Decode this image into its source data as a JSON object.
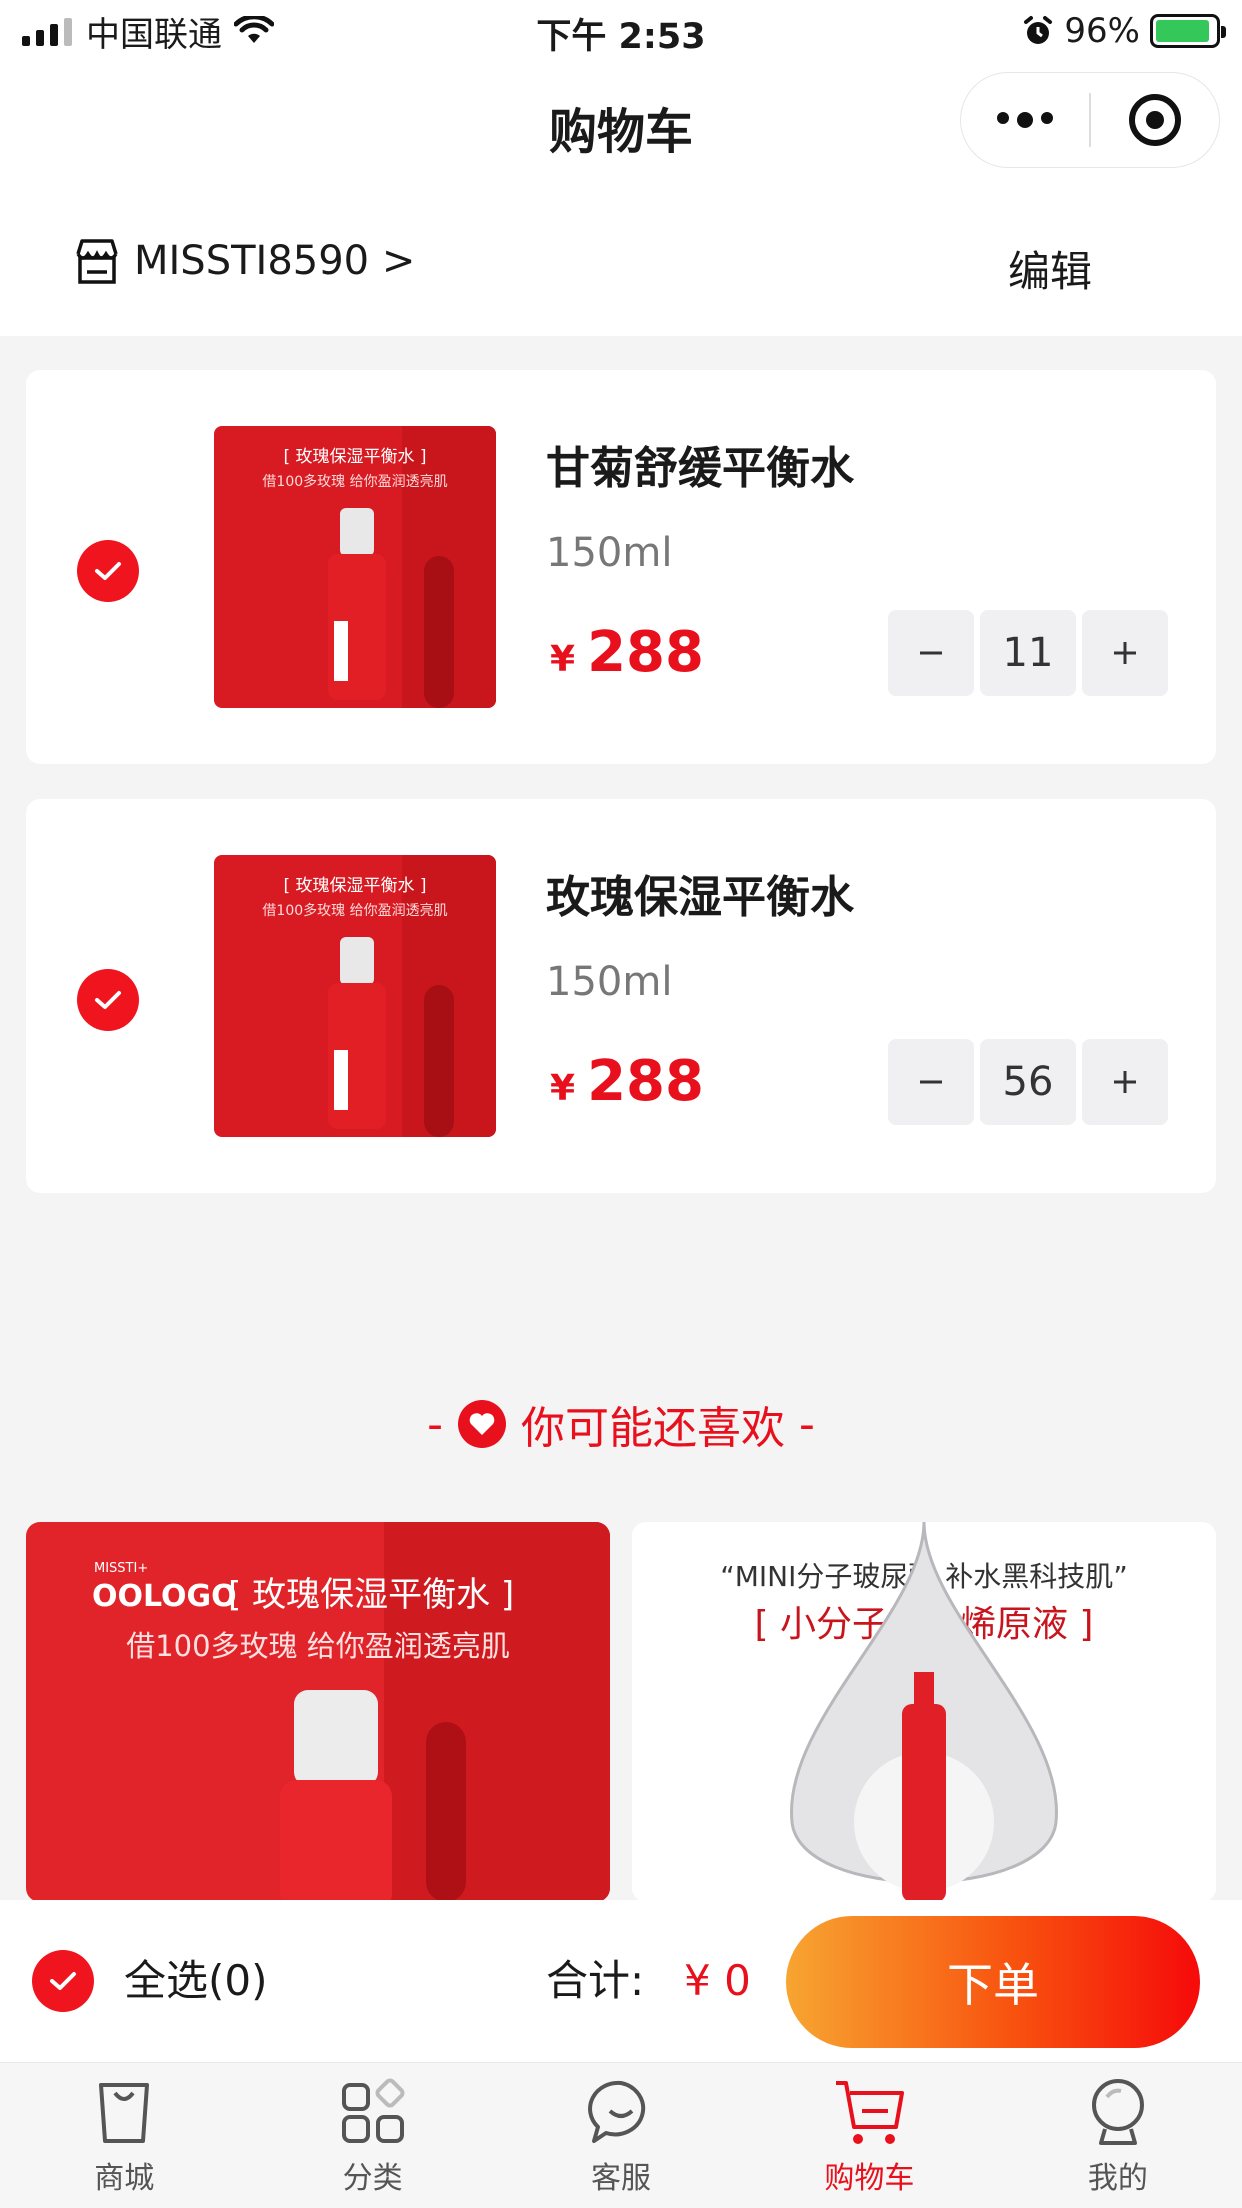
{
  "status_bar": {
    "carrier": "中国联通",
    "time": "下午 2:53",
    "battery": "96%"
  },
  "nav": {
    "title": "购物车"
  },
  "store": {
    "name": "MISSTI8590 >",
    "edit_label": "编辑"
  },
  "cart": {
    "items": [
      {
        "name": "甘菊舒缓平衡水",
        "spec": "150ml",
        "currency": "¥",
        "price": "288",
        "qty": "11",
        "checked": true
      },
      {
        "name": "玫瑰保湿平衡水",
        "spec": "150ml",
        "currency": "¥",
        "price": "288",
        "qty": "56",
        "checked": true
      }
    ],
    "product_image": {
      "brand": "OOLOGO",
      "tag": "[ 玫瑰保湿平衡水 ]",
      "sub": "借100多玫瑰 给你盈润透亮肌"
    }
  },
  "recommend": {
    "title": "你可能还喜欢",
    "tiles": [
      {
        "brand_top": "MISSTI+",
        "brand": "OOLOGO",
        "tag": "[ 玫瑰保湿平衡水 ]",
        "sub": "借100多玫瑰 给你盈润透亮肌"
      },
      {
        "quote": "“MINI分子玻尿酸 补水黑科技肌”",
        "tag": "[ 小分子富勒烯原液 ]"
      }
    ]
  },
  "footer": {
    "select_all": "全选(0)",
    "total_label": "合计:",
    "total_value": "¥ 0",
    "order_label": "下单"
  },
  "tabbar": {
    "items": [
      {
        "label": "商城",
        "icon": "bag-icon"
      },
      {
        "label": "分类",
        "icon": "category-icon"
      },
      {
        "label": "客服",
        "icon": "chat-icon"
      },
      {
        "label": "购物车",
        "icon": "cart-icon",
        "active": true
      },
      {
        "label": "我的",
        "icon": "profile-icon"
      }
    ]
  },
  "colors": {
    "accent": "#e8101c",
    "check": "#f0141e",
    "background": "#f4f4f5"
  }
}
